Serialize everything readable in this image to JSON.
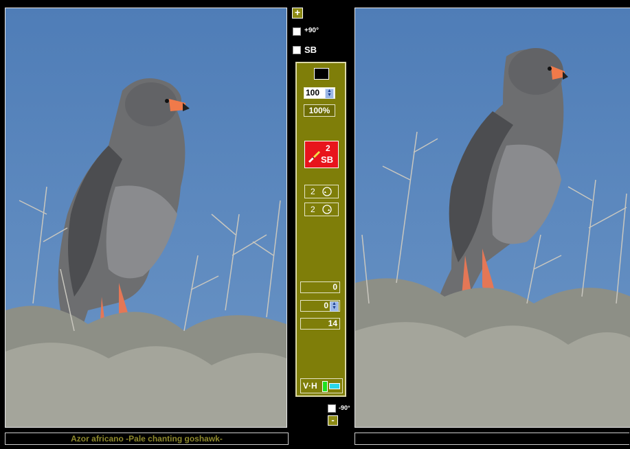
{
  "left_viewer": {
    "caption": "Azor africano -Pale chanting goshawk-"
  },
  "right_viewer": {
    "caption": ""
  },
  "top_controls": {
    "add_button_label": "+",
    "rotate_cw_label": "+90°",
    "sb_label": "SB"
  },
  "bottom_controls": {
    "rotate_ccw_label": "-90°",
    "remove_button_label": "-"
  },
  "panel": {
    "zoom_value": "100",
    "zoom_percent_label": "100%",
    "sb_button": {
      "count": "2",
      "label": "SB"
    },
    "rotate_left": {
      "count": "2"
    },
    "rotate_right": {
      "count": "2"
    },
    "field_1": "0",
    "field_2": "0",
    "field_3": "14",
    "vh_label": "V·H"
  },
  "colors": {
    "panel_bg": "#7f7e09",
    "caption_text": "#8f8a2c",
    "sb_button_bg": "#e8141c",
    "sky": "#5b86ba"
  },
  "icons": {
    "brush": "brush-icon",
    "rotate_left": "rotate-left-icon",
    "rotate_right": "rotate-right-icon",
    "spinner": "spinner-arrows-icon",
    "color_swatch": "black-swatch-icon",
    "vh_toggle": "vertical-horizontal-icon"
  }
}
